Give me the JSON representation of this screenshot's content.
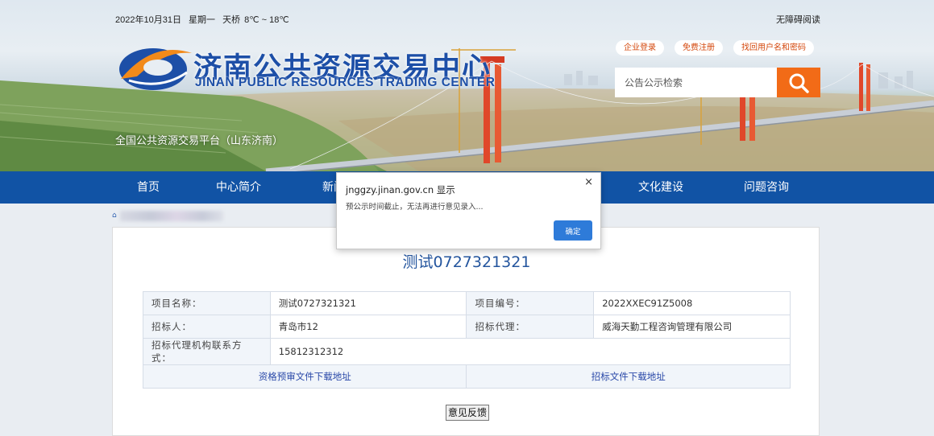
{
  "header": {
    "date": "2022年10月31日",
    "weekday": "星期一",
    "weather_label": "天桥",
    "temperature": "8℃ ~ 18℃",
    "accessibility_link": "无障碍阅读",
    "logo_cn": "济南公共资源交易中心",
    "logo_en": "JINAN PUBLIC RESOURCES TRADING CENTER",
    "platform_text": "全国公共资源交易平台（山东济南）",
    "links": {
      "login": "企业登录",
      "register": "免费注册",
      "recover": "找回用户名和密码"
    },
    "search": {
      "placeholder": "公告公示检索"
    }
  },
  "nav": {
    "items": [
      "首页",
      "中心简介",
      "新闻",
      "",
      "",
      "文化建设",
      "问题咨询"
    ]
  },
  "project": {
    "title": "测试0727321321",
    "rows": {
      "name_label": "项目名称：",
      "name_value": "测试0727321321",
      "code_label": "项目编号：",
      "code_value": "2022XXEC91Z5008",
      "tenderer_label": "招标人：",
      "tenderer_value": "青岛市12",
      "agent_label": "招标代理：",
      "agent_value": "威海天勤工程咨询管理有限公司",
      "contact_label": "招标代理机构联系方式：",
      "contact_value": "15812312312",
      "prequal_link": "资格预审文件下载地址",
      "bid_link": "招标文件下载地址"
    },
    "feedback_button": "意见反馈"
  },
  "dialog": {
    "title": "jnggzy.jinan.gov.cn 显示",
    "message": "预公示时间截止，无法再进行意见录入...",
    "ok": "确定",
    "close": "×"
  },
  "colors": {
    "nav_bg": "#1153a5",
    "search_button": "#f26b17",
    "brand_blue": "#1d4fa7",
    "dialog_button": "#2e7bd9"
  }
}
